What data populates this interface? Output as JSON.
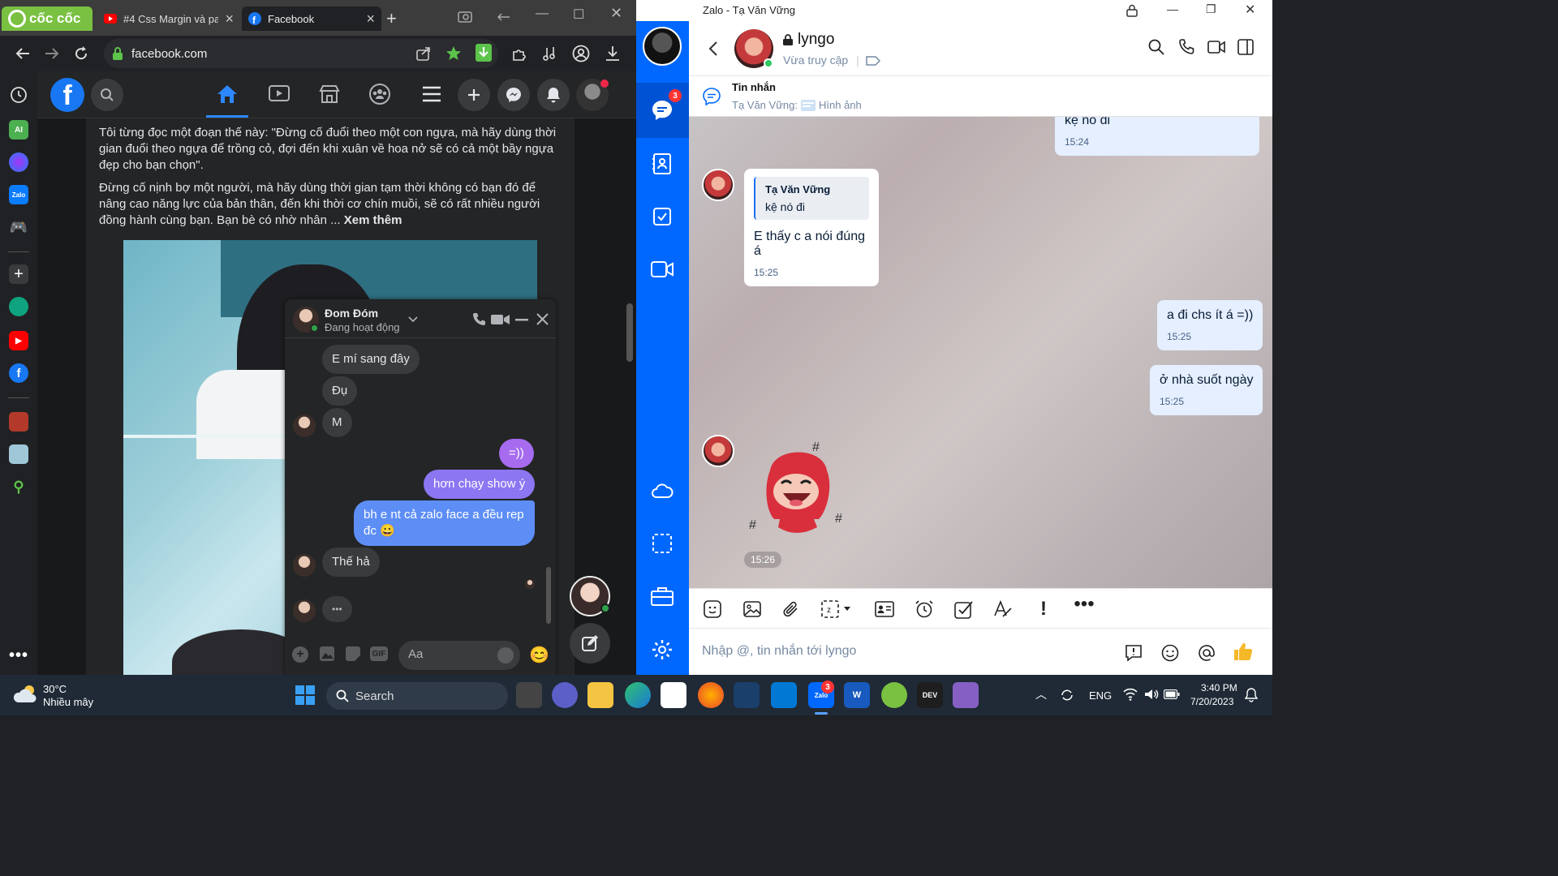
{
  "browser": {
    "brand": "cốc cốc",
    "tabs": [
      {
        "title": "#4 Css Margin và pa"
      },
      {
        "title": "Facebook"
      }
    ],
    "url": "facebook.com"
  },
  "facebook": {
    "post_paragraphs": [
      "Tôi từng đọc một đoạn thế này: \"Đừng cố đuổi theo một con ngựa, mà hãy dùng thời gian đuổi theo ngựa để trồng cỏ, đợi đến khi xuân về hoa nở sẽ có cả một bầy ngựa đẹp cho bạn chọn\".",
      "Đừng cố nịnh bợ một người, mà hãy dùng thời gian tạm thời không có bạn đó để nâng cao năng lực của bản thân, đến khi thời cơ chín muồi, sẽ có rất nhiều người đồng hành cùng bạn. Bạn bè có nhờ nhân ..."
    ],
    "see_more": "Xem thêm",
    "image_caption": "",
    "chat": {
      "name": "Đom Đóm",
      "status": "Đang hoạt động",
      "messages": [
        {
          "text": "E mí sang đây",
          "dir": "in"
        },
        {
          "text": "Đụ",
          "dir": "in"
        },
        {
          "text": "M",
          "dir": "in"
        },
        {
          "text": "=))",
          "dir": "out"
        },
        {
          "text": "hơn chạy show ý",
          "dir": "out"
        },
        {
          "text": "bh e nt cả zalo face a đều rep đc 😀",
          "dir": "out"
        },
        {
          "text": "Thế hả",
          "dir": "in"
        },
        {
          "text": "•••",
          "dir": "in"
        }
      ],
      "input_placeholder": "Aa"
    }
  },
  "zalo": {
    "window_title": "Zalo - Tạ Văn Vững",
    "rail_badge": "3",
    "contact_name": "lyngo",
    "contact_status": "Vừa truy cập",
    "pinned_title": "Tin nhắn",
    "pinned_from": "Tạ Văn Vững:",
    "pinned_text": "Hình ảnh",
    "messages": {
      "m1_text": "kệ nó đi",
      "m1_time": "15:24",
      "quote_name": "Tạ Văn Vững",
      "quote_text": "kệ nó đi",
      "m2_text": "E thấy c a nói đúng á",
      "m2_time": "15:25",
      "m3_text": "a đi chs ít á =))",
      "m3_time": "15:25",
      "m4_text": "ở nhà suốt ngày",
      "m4_time": "15:25",
      "sticker_time": "15:26"
    },
    "input_placeholder": "Nhập @, tin nhắn tới lyngo"
  },
  "taskbar": {
    "weather_temp": "30°C",
    "weather_desc": "Nhiều mây",
    "search_label": "Search",
    "lang": "ENG",
    "time": "3:40 PM",
    "date": "7/20/2023",
    "zalo_badge": "3"
  },
  "colors": {
    "fb_blue": "#1877f2",
    "zalo_blue": "#0068ff",
    "messenger_gradient_top": "#a86cf0",
    "messenger_gradient_bottom": "#4f8ff7"
  }
}
